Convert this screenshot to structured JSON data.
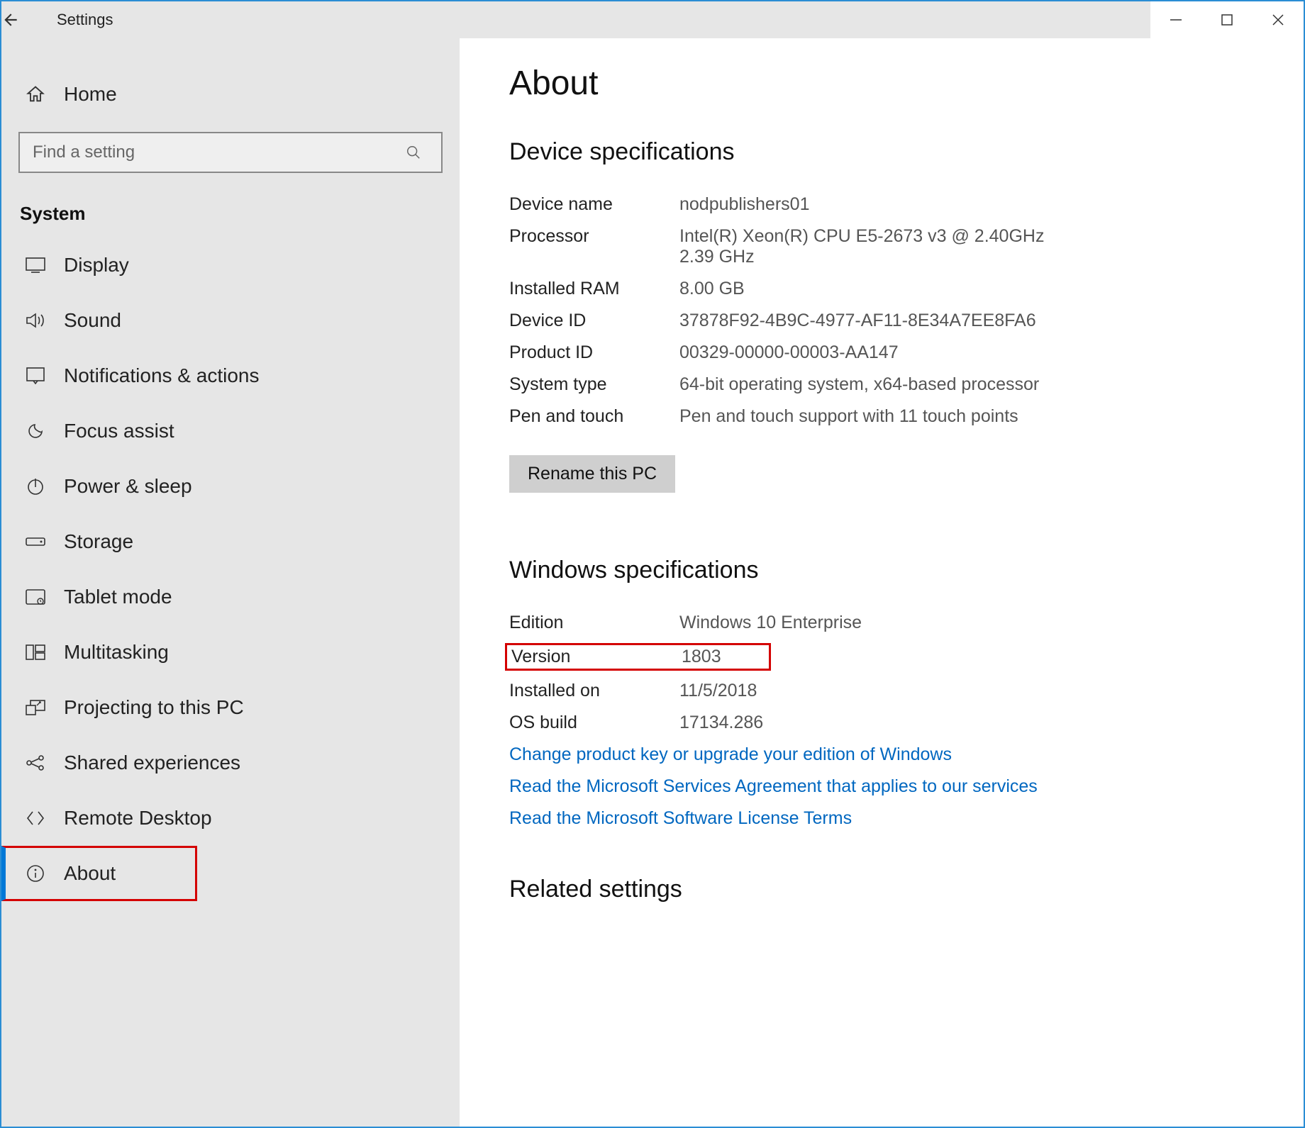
{
  "window": {
    "title": "Settings"
  },
  "sidebar": {
    "home": "Home",
    "search_placeholder": "Find a setting",
    "group": "System",
    "items": [
      {
        "icon": "display",
        "label": "Display"
      },
      {
        "icon": "sound",
        "label": "Sound"
      },
      {
        "icon": "notifications",
        "label": "Notifications & actions"
      },
      {
        "icon": "focus",
        "label": "Focus assist"
      },
      {
        "icon": "power",
        "label": "Power & sleep"
      },
      {
        "icon": "storage",
        "label": "Storage"
      },
      {
        "icon": "tablet",
        "label": "Tablet mode"
      },
      {
        "icon": "multitask",
        "label": "Multitasking"
      },
      {
        "icon": "projecting",
        "label": "Projecting to this PC"
      },
      {
        "icon": "shared",
        "label": "Shared experiences"
      },
      {
        "icon": "remote",
        "label": "Remote Desktop"
      },
      {
        "icon": "about",
        "label": "About"
      }
    ]
  },
  "main": {
    "title": "About",
    "device_spec_title": "Device specifications",
    "device": {
      "device_name_k": "Device name",
      "device_name_v": "nodpublishers01",
      "processor_k": "Processor",
      "processor_v": "Intel(R) Xeon(R) CPU E5-2673 v3 @ 2.40GHz 2.39 GHz",
      "ram_k": "Installed RAM",
      "ram_v": "8.00 GB",
      "device_id_k": "Device ID",
      "device_id_v": "37878F92-4B9C-4977-AF11-8E34A7EE8FA6",
      "product_id_k": "Product ID",
      "product_id_v": "00329-00000-00003-AA147",
      "system_type_k": "System type",
      "system_type_v": "64-bit operating system, x64-based processor",
      "pen_k": "Pen and touch",
      "pen_v": "Pen and touch support with 11 touch points"
    },
    "rename_btn": "Rename this PC",
    "win_spec_title": "Windows specifications",
    "win": {
      "edition_k": "Edition",
      "edition_v": "Windows 10 Enterprise",
      "version_k": "Version",
      "version_v": "1803",
      "installed_k": "Installed on",
      "installed_v": "11/5/2018",
      "build_k": "OS build",
      "build_v": "17134.286"
    },
    "links": {
      "product_key": "Change product key or upgrade your edition of Windows",
      "services_agreement": "Read the Microsoft Services Agreement that applies to our services",
      "license_terms": "Read the Microsoft Software License Terms"
    },
    "related_title": "Related settings"
  }
}
